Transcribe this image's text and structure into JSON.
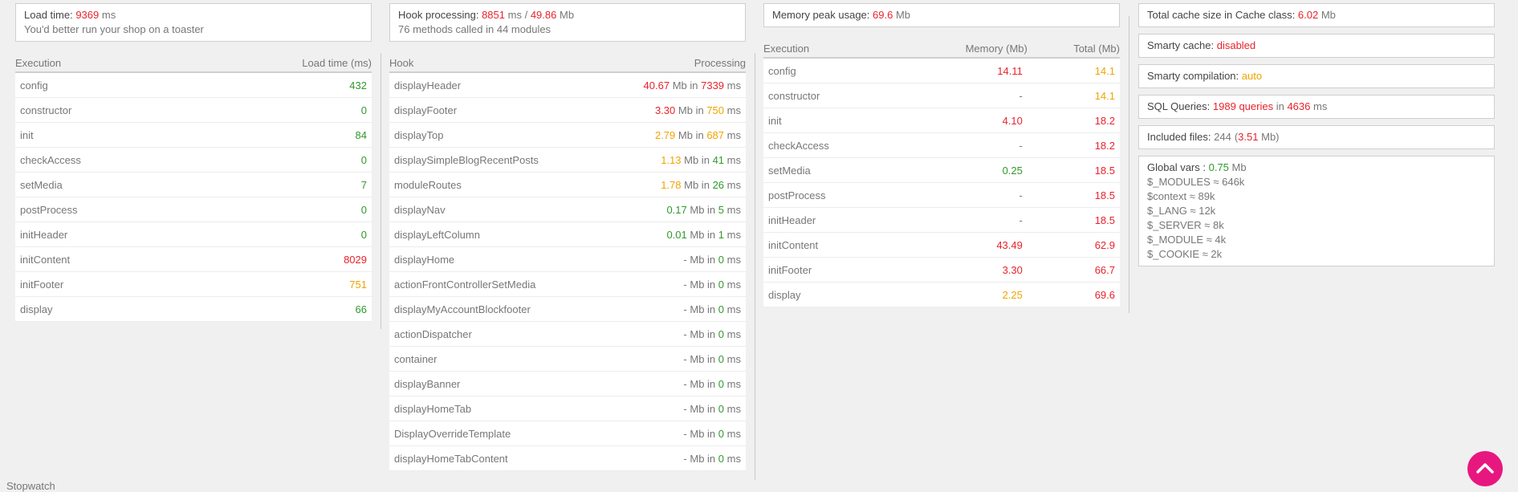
{
  "load": {
    "label": "Load time:",
    "value": "9369",
    "unit": "ms",
    "note": "You'd better run your shop on a toaster",
    "headers": [
      "Execution",
      "Load time (ms)"
    ],
    "rows": [
      {
        "name": "config",
        "value": "432",
        "color": "green"
      },
      {
        "name": "constructor",
        "value": "0",
        "color": "green"
      },
      {
        "name": "init",
        "value": "84",
        "color": "green"
      },
      {
        "name": "checkAccess",
        "value": "0",
        "color": "green"
      },
      {
        "name": "setMedia",
        "value": "7",
        "color": "green"
      },
      {
        "name": "postProcess",
        "value": "0",
        "color": "green"
      },
      {
        "name": "initHeader",
        "value": "0",
        "color": "green"
      },
      {
        "name": "initContent",
        "value": "8029",
        "color": "red"
      },
      {
        "name": "initFooter",
        "value": "751",
        "color": "orange"
      },
      {
        "name": "display",
        "value": "66",
        "color": "green"
      }
    ]
  },
  "hooks": {
    "label": "Hook processing:",
    "ms": "8851",
    "ms_unit": "ms /",
    "mb": "49.86",
    "mb_unit": "Mb",
    "note": "76 methods called in 44 modules",
    "headers": [
      "Hook",
      "Processing"
    ],
    "mb_suffix": "Mb in",
    "ms_suffix": "ms",
    "rows": [
      {
        "name": "displayHeader",
        "mb": "40.67",
        "mb_color": "red",
        "ms": "7339",
        "ms_color": "red"
      },
      {
        "name": "displayFooter",
        "mb": "3.30",
        "mb_color": "red",
        "ms": "750",
        "ms_color": "orange"
      },
      {
        "name": "displayTop",
        "mb": "2.79",
        "mb_color": "orange",
        "ms": "687",
        "ms_color": "orange"
      },
      {
        "name": "displaySimpleBlogRecentPosts",
        "mb": "1.13",
        "mb_color": "orange",
        "ms": "41",
        "ms_color": "green"
      },
      {
        "name": "moduleRoutes",
        "mb": "1.78",
        "mb_color": "orange",
        "ms": "26",
        "ms_color": "green"
      },
      {
        "name": "displayNav",
        "mb": "0.17",
        "mb_color": "green",
        "ms": "5",
        "ms_color": "green"
      },
      {
        "name": "displayLeftColumn",
        "mb": "0.01",
        "mb_color": "green",
        "ms": "1",
        "ms_color": "green"
      },
      {
        "name": "displayHome",
        "mb": "-",
        "mb_color": "gray",
        "ms": "0",
        "ms_color": "green"
      },
      {
        "name": "actionFrontControllerSetMedia",
        "mb": "-",
        "mb_color": "gray",
        "ms": "0",
        "ms_color": "green"
      },
      {
        "name": "displayMyAccountBlockfooter",
        "mb": "-",
        "mb_color": "gray",
        "ms": "0",
        "ms_color": "green"
      },
      {
        "name": "actionDispatcher",
        "mb": "-",
        "mb_color": "gray",
        "ms": "0",
        "ms_color": "green"
      },
      {
        "name": "container",
        "mb": "-",
        "mb_color": "gray",
        "ms": "0",
        "ms_color": "green"
      },
      {
        "name": "displayBanner",
        "mb": "-",
        "mb_color": "gray",
        "ms": "0",
        "ms_color": "green"
      },
      {
        "name": "displayHomeTab",
        "mb": "-",
        "mb_color": "gray",
        "ms": "0",
        "ms_color": "green"
      },
      {
        "name": "DisplayOverrideTemplate",
        "mb": "-",
        "mb_color": "gray",
        "ms": "0",
        "ms_color": "green"
      },
      {
        "name": "displayHomeTabContent",
        "mb": "-",
        "mb_color": "gray",
        "ms": "0",
        "ms_color": "green"
      }
    ]
  },
  "memory": {
    "label": "Memory peak usage:",
    "value": "69.6",
    "unit": "Mb",
    "headers": [
      "Execution",
      "Memory (Mb)",
      "Total (Mb)"
    ],
    "rows": [
      {
        "name": "config",
        "mem": "14.11",
        "mem_color": "red",
        "total": "14.1",
        "total_color": "orange"
      },
      {
        "name": "constructor",
        "mem": "-",
        "mem_color": "gray",
        "total": "14.1",
        "total_color": "orange"
      },
      {
        "name": "init",
        "mem": "4.10",
        "mem_color": "red",
        "total": "18.2",
        "total_color": "red"
      },
      {
        "name": "checkAccess",
        "mem": "-",
        "mem_color": "gray",
        "total": "18.2",
        "total_color": "red"
      },
      {
        "name": "setMedia",
        "mem": "0.25",
        "mem_color": "green",
        "total": "18.5",
        "total_color": "red"
      },
      {
        "name": "postProcess",
        "mem": "-",
        "mem_color": "gray",
        "total": "18.5",
        "total_color": "red"
      },
      {
        "name": "initHeader",
        "mem": "-",
        "mem_color": "gray",
        "total": "18.5",
        "total_color": "red"
      },
      {
        "name": "initContent",
        "mem": "43.49",
        "mem_color": "red",
        "total": "62.9",
        "total_color": "red"
      },
      {
        "name": "initFooter",
        "mem": "3.30",
        "mem_color": "red",
        "total": "66.7",
        "total_color": "red"
      },
      {
        "name": "display",
        "mem": "2.25",
        "mem_color": "orange",
        "total": "69.6",
        "total_color": "red"
      }
    ]
  },
  "stats": {
    "cache": {
      "label": "Total cache size in Cache class:",
      "value": "6.02",
      "unit": "Mb"
    },
    "smarty_cache": {
      "label": "Smarty cache:",
      "value": "disabled"
    },
    "smarty_compilation": {
      "label": "Smarty compilation:",
      "value": "auto"
    },
    "sql": {
      "label": "SQL Queries:",
      "queries": "1989 queries",
      "in": "in",
      "ms": "4636",
      "ms_unit": "ms"
    },
    "files": {
      "label": "Included files:",
      "count": "244",
      "paren_open": "(",
      "size": "3.51",
      "size_unit": "Mb)"
    },
    "globals": {
      "label": "Global vars :",
      "value": "0.75",
      "unit": "Mb",
      "items": [
        "$_MODULES ≈ 646k",
        "$context ≈ 89k",
        "$_LANG ≈ 12k",
        "$_SERVER ≈ 8k",
        "$_MODULE ≈ 4k",
        "$_COOKIE ≈ 2k"
      ]
    }
  },
  "footer": {
    "stopwatch": "Stopwatch",
    "top_icon": "chevron-up-icon",
    "top_button_color": "#e8177f"
  },
  "colors": {
    "red": "#e8232c",
    "orange": "#f0a400",
    "green": "#2f9a2a"
  }
}
